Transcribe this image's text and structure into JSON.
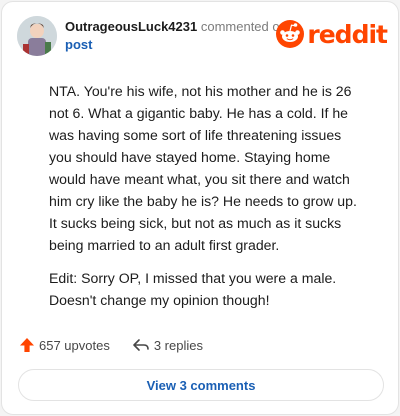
{
  "header": {
    "author": "OutrageousLuck4231",
    "verb": "commented on",
    "target": "post",
    "brand_name": "reddit"
  },
  "comment": {
    "paragraphs": [
      "NTA. You're his wife, not his mother and he is 26 not 6. What a gigantic baby. He has a cold. If he was having some sort of life threatening issues you should have stayed home. Staying home would have meant what, you sit there and watch him cry like the baby he is? He needs to grow up. It sucks being sick, but not as much as it sucks being married to an adult first grader.",
      "Edit: Sorry OP, I missed that you were a male. Doesn't change my opinion though!"
    ]
  },
  "actions": {
    "upvotes": "657 upvotes",
    "replies": "3 replies"
  },
  "footer": {
    "view_comments": "View 3 comments"
  },
  "colors": {
    "brand": "#ff4500",
    "link": "#1a5fb4",
    "text": "#1c1c1c"
  },
  "icons": [
    "avatar",
    "reddit-logo-icon",
    "upvote-arrow-icon",
    "reply-arrow-icon"
  ]
}
